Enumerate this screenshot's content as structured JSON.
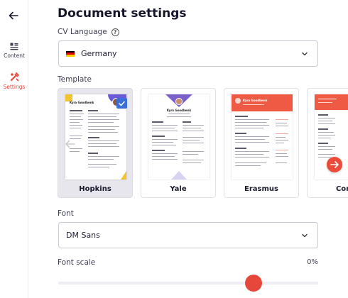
{
  "rail": {
    "items": [
      {
        "label": "Content",
        "icon": "content-icon",
        "active": false
      },
      {
        "label": "Settings",
        "icon": "settings-icon",
        "active": true
      }
    ]
  },
  "page": {
    "title": "Document settings"
  },
  "language": {
    "label": "CV Language",
    "value": "Germany",
    "flag_colors": [
      "#000000",
      "#dd0000",
      "#ffce00"
    ]
  },
  "template": {
    "label": "Template",
    "selected": "Hopkins",
    "cards": [
      {
        "name": "Hopkins",
        "selected": true
      },
      {
        "name": "Yale",
        "selected": false
      },
      {
        "name": "Erasmus",
        "selected": false
      },
      {
        "name": "Corr",
        "selected": false
      }
    ],
    "thumbnails": {
      "hopkins": {
        "name_text": "Kyra Goodbenk"
      },
      "yale": {
        "name_text": "Kyra Goodbenk"
      },
      "erasmus": {
        "name_text": "Kyra Goodbenk"
      }
    }
  },
  "font": {
    "label": "Font",
    "value": "DM Sans"
  },
  "font_scale": {
    "label": "Font scale",
    "value_text": "0%",
    "fraction": 0.75
  },
  "colors": {
    "accent": "#e5473b",
    "check": "#3a6fd8",
    "yale_purple": "#7b61c9",
    "erasmus_red": "#ef5a45"
  }
}
